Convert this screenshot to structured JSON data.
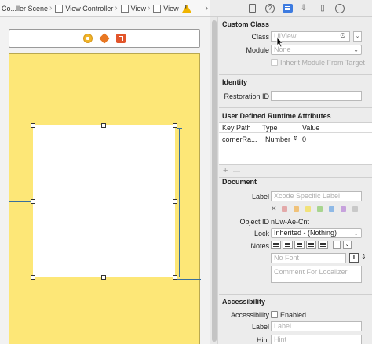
{
  "jumpbar": {
    "crumbs": [
      "Co...ller Scene",
      "View Controller",
      "View",
      "View"
    ]
  },
  "inspector": {
    "custom_class": {
      "title": "Custom Class",
      "class_label": "Class",
      "class_placeholder": "UIView",
      "module_label": "Module",
      "module_value": "None",
      "inherit_label": "Inherit Module From Target"
    },
    "identity": {
      "title": "Identity",
      "restoration_label": "Restoration ID"
    },
    "udra": {
      "title": "User Defined Runtime Attributes",
      "headers": [
        "Key Path",
        "Type",
        "Value"
      ],
      "rows": [
        {
          "key_path": "cornerRa...",
          "type": "Number",
          "value": "0"
        }
      ],
      "add_label": "+",
      "remove_label": "—"
    },
    "document": {
      "title": "Document",
      "label_label": "Label",
      "label_placeholder": "Xcode Specific Label",
      "swatch_colors": [
        "#e3a9a9",
        "#f0c27a",
        "#f2e27a",
        "#a8d58f",
        "#8fb9e6",
        "#c7a2dd",
        "#c9c9c9"
      ],
      "object_id_label": "Object ID",
      "object_id_value": "nUw-Ae-Cnt",
      "lock_label": "Lock",
      "lock_value": "Inherited - (Nothing)",
      "notes_label": "Notes",
      "font_placeholder": "No Font",
      "comment_placeholder": "Comment For Localizer"
    },
    "accessibility": {
      "title": "Accessibility",
      "accessibility_label": "Accessibility",
      "enabled_label": "Enabled",
      "label_label": "Label",
      "label_placeholder": "Label",
      "hint_label": "Hint",
      "hint_placeholder": "Hint"
    }
  }
}
